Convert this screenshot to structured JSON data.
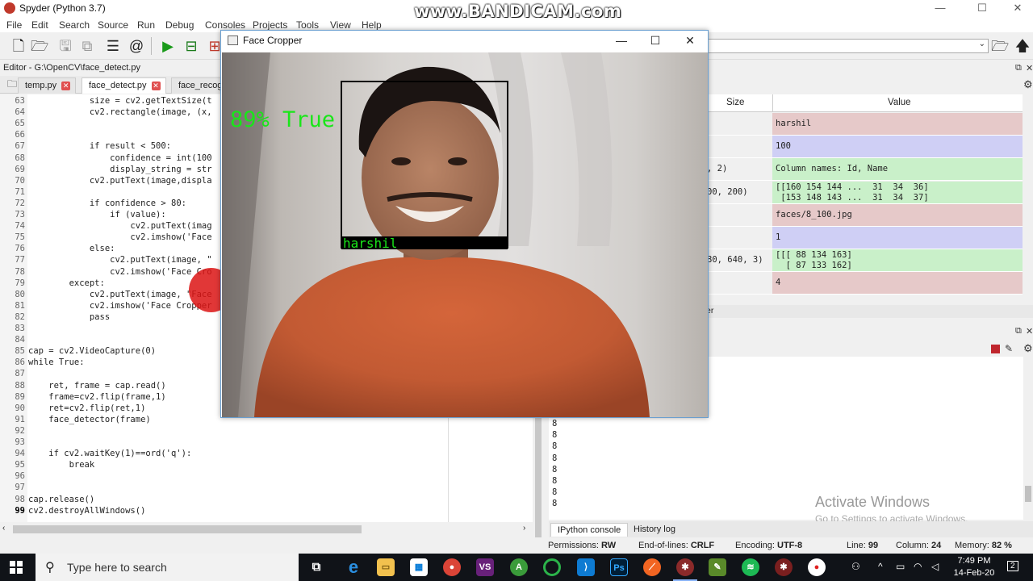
{
  "window": {
    "title": "Spyder (Python 3.7)",
    "watermark": "www.BANDICAM.com",
    "minimize": "—",
    "maximize": "☐",
    "close": "✕"
  },
  "menu": [
    "File",
    "Edit",
    "Search",
    "Source",
    "Run",
    "Debug",
    "Consoles",
    "Projects",
    "Tools",
    "View",
    "Help"
  ],
  "editor": {
    "label": "Editor - G:\\OpenCV\\face_detect.py",
    "tabs": [
      "temp.py",
      "face_detect.py",
      "face_recog"
    ],
    "lines": [
      {
        "n": "63",
        "t": "            size = cv2.getTextSize(t"
      },
      {
        "n": "64",
        "t": "            cv2.rectangle(image, (x,"
      },
      {
        "n": "65",
        "t": ""
      },
      {
        "n": "66",
        "t": ""
      },
      {
        "n": "67",
        "t": "            if result < 500:"
      },
      {
        "n": "68",
        "t": "                confidence = int(100"
      },
      {
        "n": "69",
        "t": "                display_string = str"
      },
      {
        "n": "70",
        "t": "            cv2.putText(image,displa"
      },
      {
        "n": "71",
        "t": ""
      },
      {
        "n": "72",
        "t": "            if confidence > 80:"
      },
      {
        "n": "73",
        "t": "                if (value):"
      },
      {
        "n": "74",
        "t": "                    cv2.putText(imag"
      },
      {
        "n": "75",
        "t": "                    cv2.imshow('Face"
      },
      {
        "n": "76",
        "t": "            else:"
      },
      {
        "n": "77",
        "t": "                cv2.putText(image, \""
      },
      {
        "n": "78",
        "t": "                cv2.imshow('Face Cro"
      },
      {
        "n": "79",
        "t": "        except:"
      },
      {
        "n": "80",
        "t": "            cv2.putText(image, \"Face"
      },
      {
        "n": "81",
        "t": "            cv2.imshow('Face Cropper"
      },
      {
        "n": "82",
        "t": "            pass"
      },
      {
        "n": "83",
        "t": ""
      },
      {
        "n": "84",
        "t": ""
      },
      {
        "n": "85",
        "t": "cap = cv2.VideoCapture(0)"
      },
      {
        "n": "86",
        "t": "while True:"
      },
      {
        "n": "87",
        "t": ""
      },
      {
        "n": "88",
        "t": "    ret, frame = cap.read()"
      },
      {
        "n": "89",
        "t": "    frame=cv2.flip(frame,1)"
      },
      {
        "n": "90",
        "t": "    ret=cv2.flip(ret,1)"
      },
      {
        "n": "91",
        "t": "    face_detector(frame)"
      },
      {
        "n": "92",
        "t": ""
      },
      {
        "n": "93",
        "t": ""
      },
      {
        "n": "94",
        "t": "    if cv2.waitKey(1)==ord('q'):"
      },
      {
        "n": "95",
        "t": "        break"
      },
      {
        "n": "96",
        "t": ""
      },
      {
        "n": "97",
        "t": ""
      },
      {
        "n": "98",
        "t": "cap.release()"
      },
      {
        "n": "99",
        "t": "cv2.destroyAllWindows()"
      }
    ]
  },
  "variables": {
    "headers": {
      "size": "Size",
      "value": "Value"
    },
    "rows": [
      {
        "size": "",
        "value": "harshil",
        "color": "#e6c9c9"
      },
      {
        "size": "",
        "value": "100",
        "color": "#cfcff5"
      },
      {
        "size": ", 2)",
        "value": "Column names: Id, Name",
        "color": "#c9f0c9"
      },
      {
        "size": "00, 200)",
        "value": "[[160 154 144 ...  31  34  36]\n [153 148 143 ...  31  34  37]",
        "color": "#c9f0c9"
      },
      {
        "size": "",
        "value": "faces/8_100.jpg",
        "color": "#e6c9c9"
      },
      {
        "size": "",
        "value": "1",
        "color": "#cfcff5"
      },
      {
        "size": "80, 640, 3)",
        "value": "[[[ 88 134 163]\n  [ 87 133 162]",
        "color": "#c9f0c9"
      },
      {
        "size": "",
        "value": "4",
        "color": "#e6c9c9"
      }
    ],
    "bottom_tab": "er"
  },
  "console": {
    "outputs": [
      "8",
      "8",
      "8",
      "8",
      "8",
      "8",
      "8",
      "8"
    ],
    "tabs": [
      "IPython console",
      "History log"
    ],
    "activate_title": "Activate Windows",
    "activate_sub": "Go to Settings to activate Windows."
  },
  "status": {
    "permissions_label": "Permissions:",
    "permissions": "RW",
    "eol_label": "End-of-lines:",
    "eol": "CRLF",
    "encoding_label": "Encoding:",
    "encoding": "UTF-8",
    "line_label": "Line:",
    "line": "99",
    "column_label": "Column:",
    "column": "24",
    "memory_label": "Memory:",
    "memory": "82 %"
  },
  "face_cropper": {
    "title": "Face Cropper",
    "confidence_text": "89% True",
    "name_label": "harshil",
    "text_color": "#19e619"
  },
  "taskbar": {
    "search_placeholder": "Type here to search",
    "time": "7:49 PM",
    "date": "14-Feb-20",
    "notifications": "2"
  }
}
